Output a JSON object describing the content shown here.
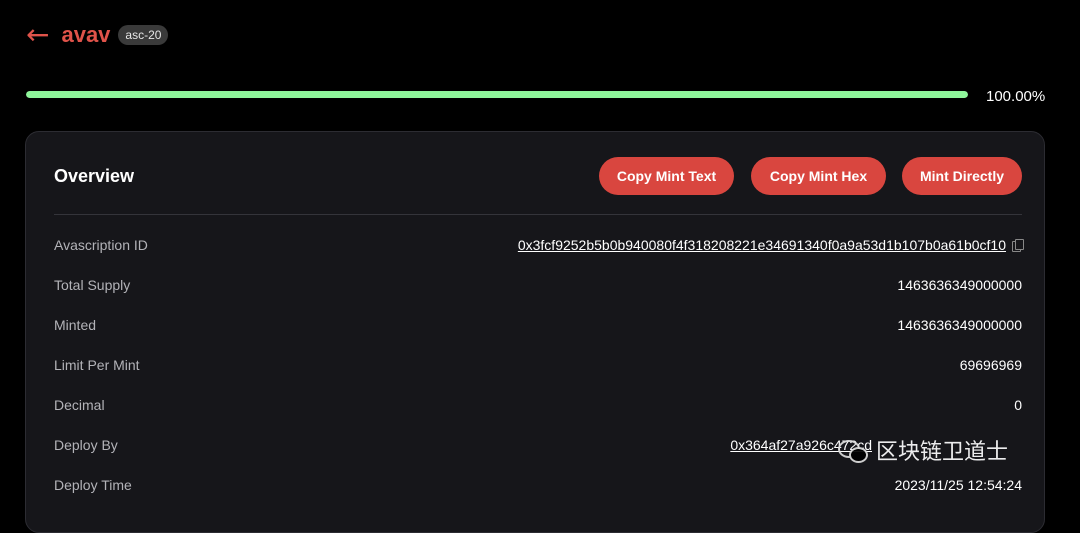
{
  "header": {
    "back_icon": "arrow-left-icon",
    "back_glyph": "←",
    "ticker": "avav",
    "badge": "asc-20"
  },
  "progress": {
    "percent": 100,
    "label": "100.00%"
  },
  "colors": {
    "accent": "#d9463f",
    "progress": "#8ef59a",
    "card_bg": "#16161a"
  },
  "overview": {
    "title": "Overview",
    "buttons": {
      "copy_text": "Copy Mint Text",
      "copy_hex": "Copy Mint Hex",
      "mint": "Mint Directly"
    },
    "rows": [
      {
        "label": "Avascription ID",
        "value": "0x3fcf9252b5b0b940080f4f318208221e34691340f0a9a53d1b107b0a61b0cf10"
      },
      {
        "label": "Total Supply",
        "value": "1463636349000000"
      },
      {
        "label": "Minted",
        "value": "1463636349000000"
      },
      {
        "label": "Limit Per Mint",
        "value": "69696969"
      },
      {
        "label": "Decimal",
        "value": "0"
      },
      {
        "label": "Deploy By",
        "value": "0x364af27a926c472cd"
      },
      {
        "label": "Deploy Time",
        "value": "2023/11/25 12:54:24"
      }
    ]
  },
  "watermark": {
    "text": "区块链卫道士",
    "icon": "wechat-icon"
  }
}
